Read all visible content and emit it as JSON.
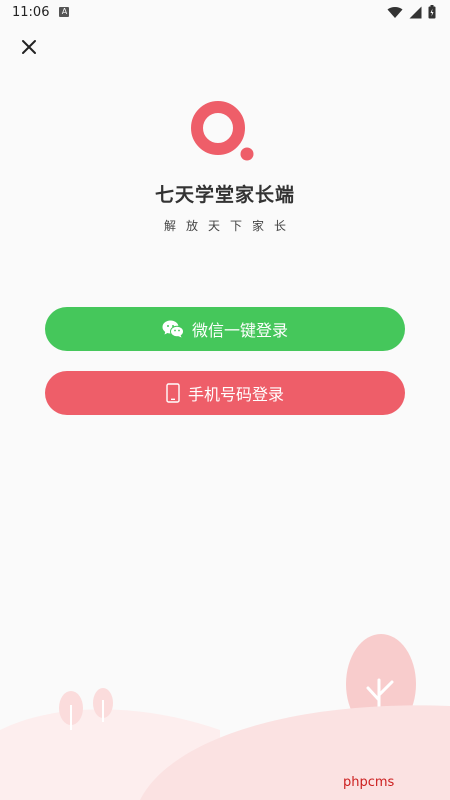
{
  "status_bar": {
    "time": "11:06",
    "notification_icon": "a-icon",
    "icons": [
      "wifi-icon",
      "signal-icon",
      "battery-icon"
    ]
  },
  "header": {
    "close_icon": "close-icon"
  },
  "app": {
    "title": "七天学堂家长端",
    "slogan": "解放天下家长",
    "brand_color": "#ee5e69"
  },
  "login": {
    "wechat_label": "微信一键登录",
    "wechat_icon": "wechat-icon",
    "wechat_color": "#45c75b",
    "phone_label": "手机号码登录",
    "phone_icon": "phone-icon",
    "phone_color": "#ee5e69"
  },
  "watermark": {
    "text": "phpcms"
  }
}
